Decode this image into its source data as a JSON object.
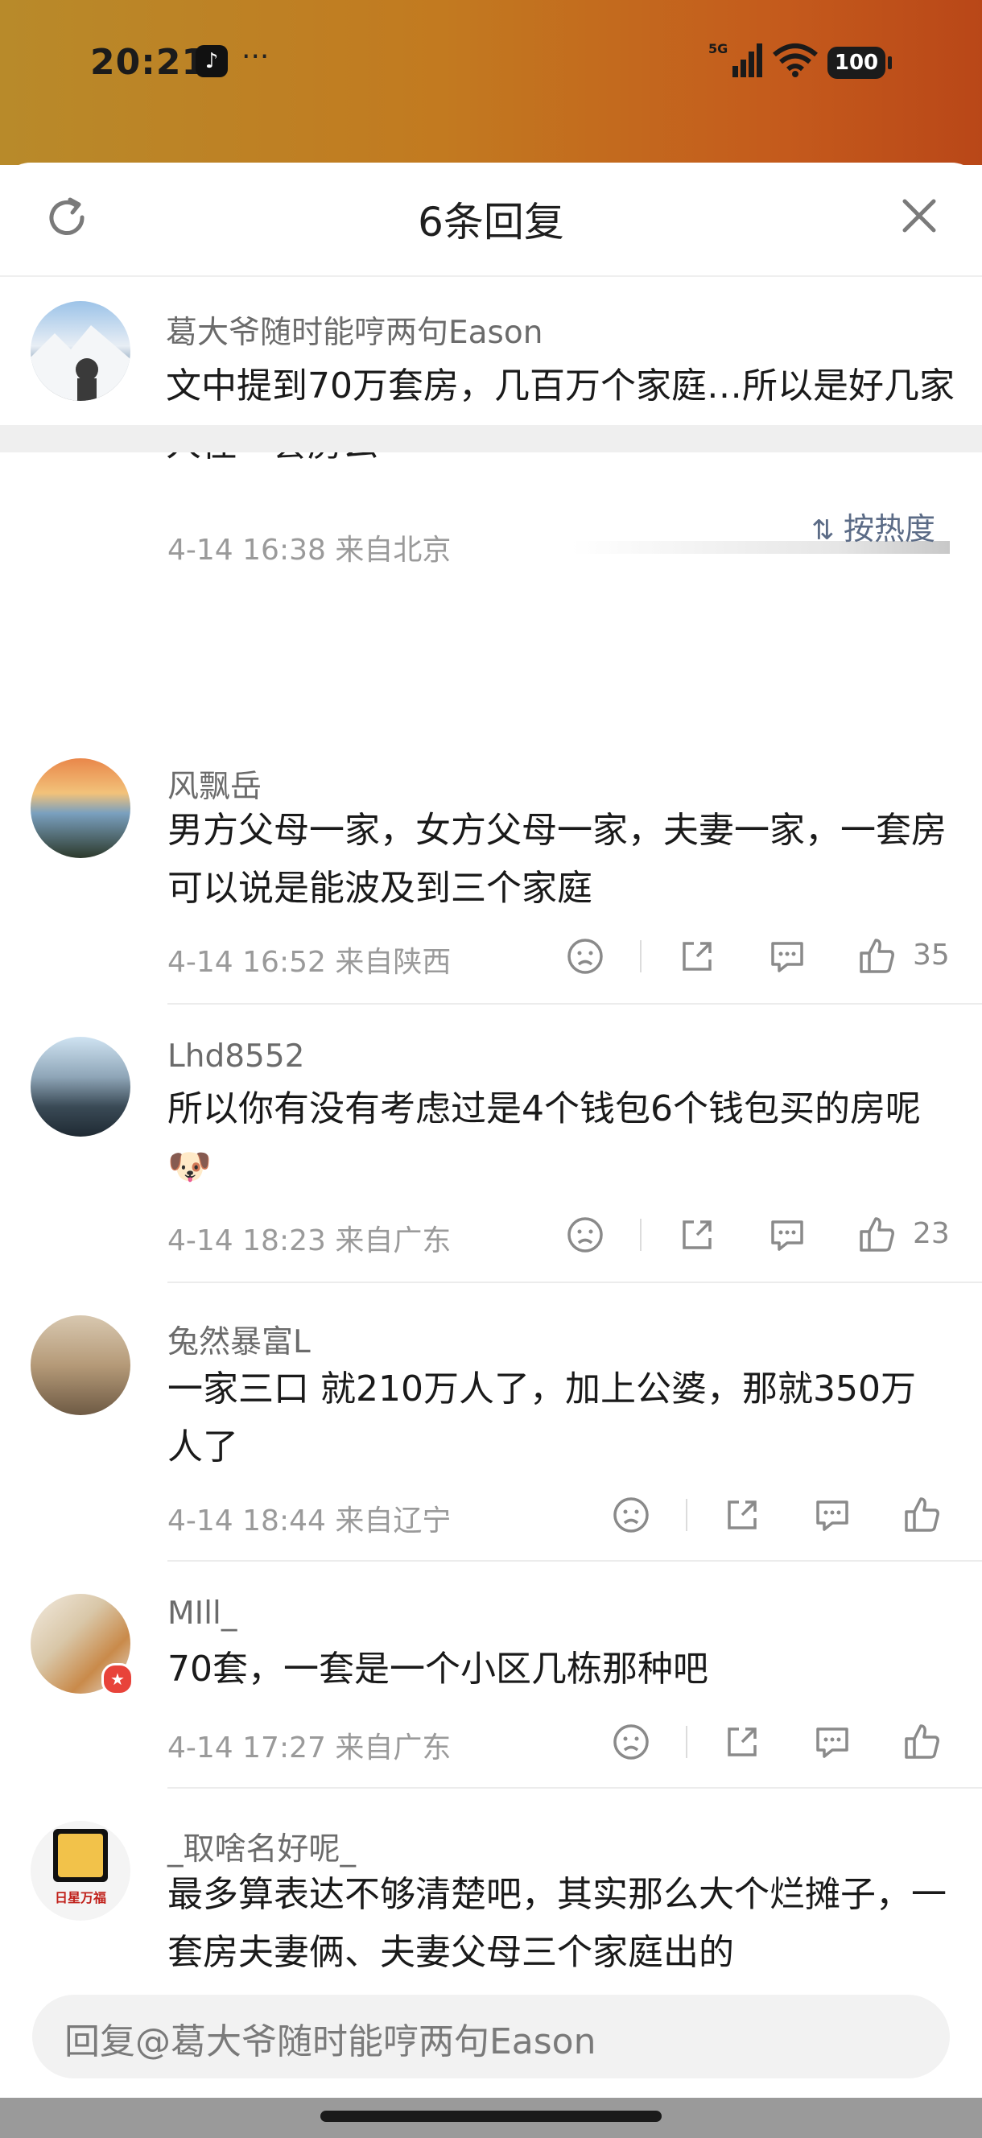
{
  "status": {
    "time": "20:21",
    "dots": "···",
    "network": "5G",
    "battery": "100"
  },
  "header": {
    "title": "6条回复"
  },
  "main_comment": {
    "name": "葛大爷随时能哼两句Eason",
    "text": "文中提到70万套房，几百万个家庭…所以是好几家人住一套房么",
    "meta": "4-14 16:38 来自北京"
  },
  "sort_label": "按热度",
  "replies": [
    {
      "name": "风飘岳",
      "text": "男方父母一家，女方父母一家，夫妻一家，一套房可以说是能波及到三个家庭",
      "meta": "4-14 16:52 来自陕西",
      "likes": "35"
    },
    {
      "name": "Lhd8552",
      "text": "所以你有没有考虑过是4个钱包6个钱包买的房呢",
      "emoji": "🐶",
      "meta": "4-14 18:23 来自广东",
      "likes": "23"
    },
    {
      "name": "兔然暴富L",
      "text": "一家三口 就210万人了，加上公婆，那就350万人了",
      "meta": "4-14 18:44 来自辽宁",
      "likes": ""
    },
    {
      "name": "MIll_",
      "text": "70套，一套是一个小区几栋那种吧",
      "meta": "4-14 17:27 来自广东",
      "likes": ""
    },
    {
      "name": "_取啥名好呢_",
      "text": "最多算表达不够清楚吧，其实那么大个烂摊子，一套房夫妻俩、夫妻父母三个家庭出的",
      "avatar_text": "日星万福"
    }
  ],
  "reply_input": {
    "placeholder": "回复@葛大爷随时能哼两句Eason"
  },
  "colors": {
    "accent": "#5b6b86",
    "text": "#1a1a1a",
    "meta": "#9a9a9a"
  }
}
